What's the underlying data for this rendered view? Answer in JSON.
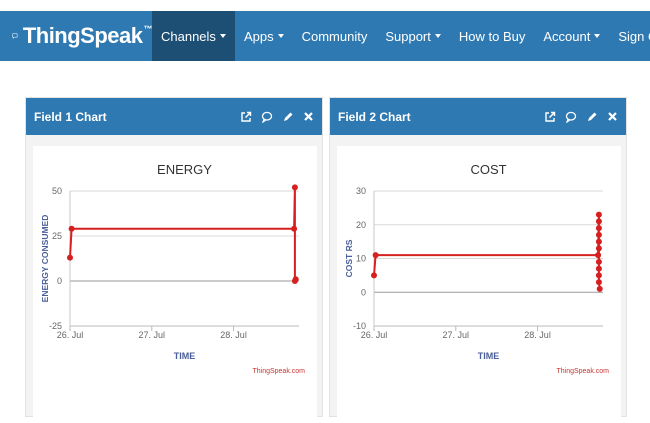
{
  "navbar": {
    "brand": "ThingSpeak",
    "brand_mark": "™",
    "items": [
      {
        "label": "Channels",
        "dropdown": true,
        "active": true
      },
      {
        "label": "Apps",
        "dropdown": true
      },
      {
        "label": "Community",
        "dropdown": false
      },
      {
        "label": "Support",
        "dropdown": true
      }
    ],
    "right_items": [
      {
        "label": "How to Buy",
        "dropdown": false
      },
      {
        "label": "Account",
        "dropdown": true
      },
      {
        "label": "Sign Out",
        "dropdown": false
      }
    ]
  },
  "panels": [
    {
      "title": "Field 1 Chart",
      "icons": [
        "external-link-icon",
        "comment-icon",
        "pencil-icon",
        "close-icon"
      ]
    },
    {
      "title": "Field 2 Chart",
      "icons": [
        "external-link-icon",
        "comment-icon",
        "pencil-icon",
        "close-icon"
      ]
    }
  ],
  "colors": {
    "brand_blue": "#2f79b3",
    "active_nav": "#1d4e74",
    "series": "#d62020",
    "axis_title": "#4a5e9a",
    "credit": "#cc3333"
  },
  "chart_data": [
    {
      "type": "line",
      "title": "ENERGY",
      "xlabel": "TIME",
      "ylabel": "ENERGY CONSUMED",
      "x_ticks": [
        "26. Jul",
        "27. Jul",
        "28. Jul"
      ],
      "y_ticks": [
        -25,
        0,
        25,
        50
      ],
      "ylim": [
        -25,
        50
      ],
      "grid": true,
      "credit": "ThingSpeak.com",
      "series": [
        {
          "points": [
            {
              "x": 0.0,
              "y": 13
            },
            {
              "x": 0.02,
              "y": 29
            },
            {
              "x": 2.74,
              "y": 29
            },
            {
              "x": 2.75,
              "y": 52
            },
            {
              "x": 2.75,
              "y": 0
            },
            {
              "x": 2.76,
              "y": 1
            }
          ]
        }
      ]
    },
    {
      "type": "line",
      "title": "COST",
      "xlabel": "TIME",
      "ylabel": "COST RS",
      "x_ticks": [
        "26. Jul",
        "27. Jul",
        "28. Jul"
      ],
      "y_ticks": [
        -10,
        0,
        10,
        20,
        30
      ],
      "ylim": [
        -10,
        30
      ],
      "grid": true,
      "credit": "ThingSpeak.com",
      "series": [
        {
          "points": [
            {
              "x": 0.0,
              "y": 5
            },
            {
              "x": 0.02,
              "y": 11
            },
            {
              "x": 2.74,
              "y": 11
            },
            {
              "x": 2.75,
              "y": 23
            },
            {
              "x": 2.75,
              "y": 21
            },
            {
              "x": 2.75,
              "y": 19
            },
            {
              "x": 2.75,
              "y": 17
            },
            {
              "x": 2.75,
              "y": 15
            },
            {
              "x": 2.75,
              "y": 13
            },
            {
              "x": 2.75,
              "y": 9
            },
            {
              "x": 2.75,
              "y": 7
            },
            {
              "x": 2.75,
              "y": 5
            },
            {
              "x": 2.75,
              "y": 3
            },
            {
              "x": 2.76,
              "y": 1
            }
          ]
        }
      ]
    }
  ]
}
